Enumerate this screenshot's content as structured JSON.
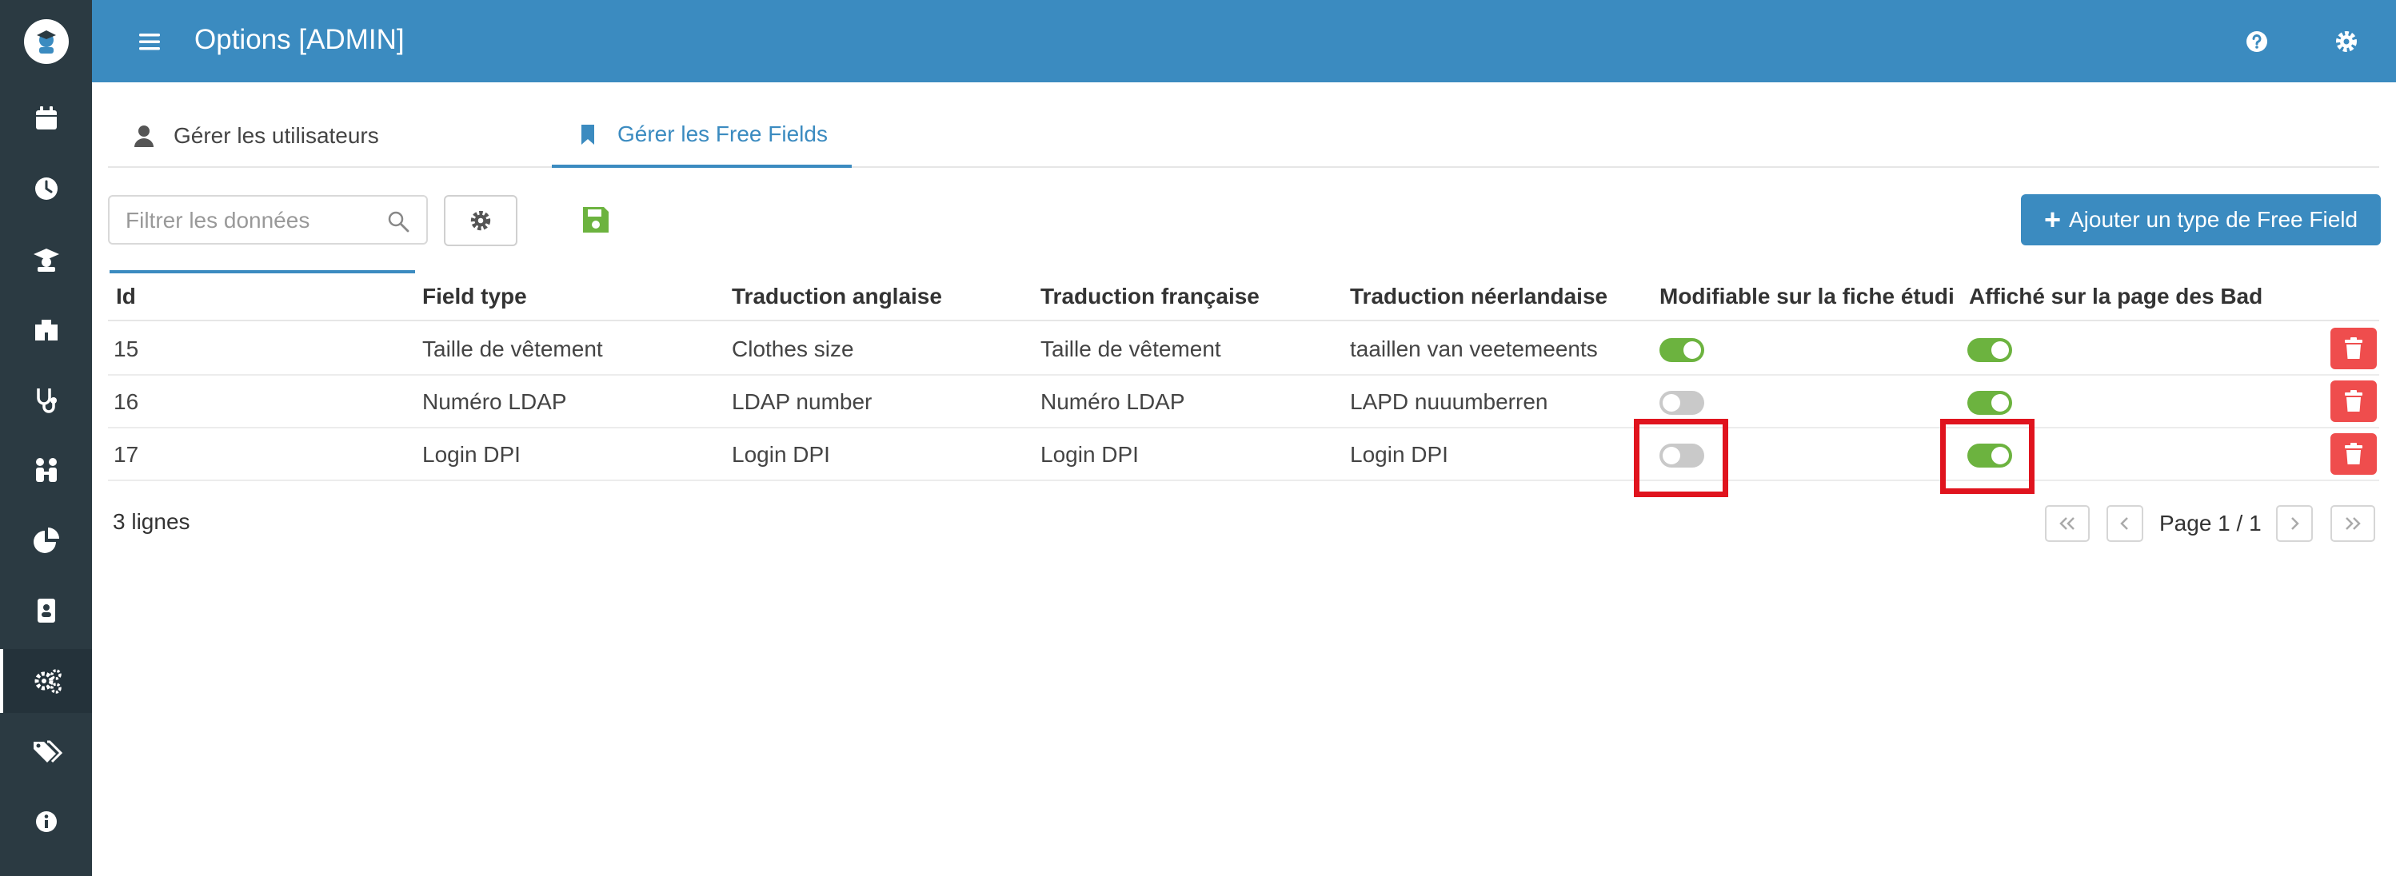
{
  "window": {
    "title": "Options [ADMIN]"
  },
  "colors": {
    "header": "#3b8bc0",
    "sidebar": "#2b3a42",
    "toggle_on": "#6cb33f",
    "toggle_off": "#c9c9c9",
    "delete": "#ef4d4d",
    "save_icon": "#6cb33f"
  },
  "sidebar": {
    "items": [
      {
        "icon": "calendar-icon"
      },
      {
        "icon": "clock-icon"
      },
      {
        "icon": "graduation-cap-icon"
      },
      {
        "icon": "building-icon"
      },
      {
        "icon": "stethoscope-icon"
      },
      {
        "icon": "people-icon"
      },
      {
        "icon": "pie-chart-icon"
      },
      {
        "icon": "contact-book-icon"
      },
      {
        "icon": "gears-icon",
        "active": true
      },
      {
        "icon": "tags-icon"
      },
      {
        "icon": "info-icon"
      }
    ]
  },
  "tabs": [
    {
      "label": "Gérer les utilisateurs",
      "icon": "user-icon",
      "active": false
    },
    {
      "label": "Gérer les Free Fields",
      "icon": "bookmark-icon",
      "active": true
    }
  ],
  "toolbar": {
    "filter_placeholder": "Filtrer les données",
    "add_button_label": "Ajouter un type de Free Field"
  },
  "table": {
    "columns": [
      "Id",
      "Field type",
      "Traduction anglaise",
      "Traduction française",
      "Traduction néerlandaise",
      "Modifiable sur la fiche étudi…",
      "Affiché sur la page des Bad…"
    ],
    "rows": [
      {
        "id": "15",
        "field_type": "Taille de vêtement",
        "en": "Clothes size",
        "fr": "Taille de vêtement",
        "nl": "taaillen van veetemeents",
        "editable": true,
        "shown": true
      },
      {
        "id": "16",
        "field_type": "Numéro LDAP",
        "en": "LDAP number",
        "fr": "Numéro LDAP",
        "nl": "LAPD nuuumberren",
        "editable": false,
        "shown": true
      },
      {
        "id": "17",
        "field_type": "Login DPI",
        "en": "Login DPI",
        "fr": "Login DPI",
        "nl": "Login DPI",
        "editable": false,
        "shown": true
      }
    ]
  },
  "footer": {
    "row_count": "3 lignes",
    "page_label": "Page 1 / 1"
  }
}
